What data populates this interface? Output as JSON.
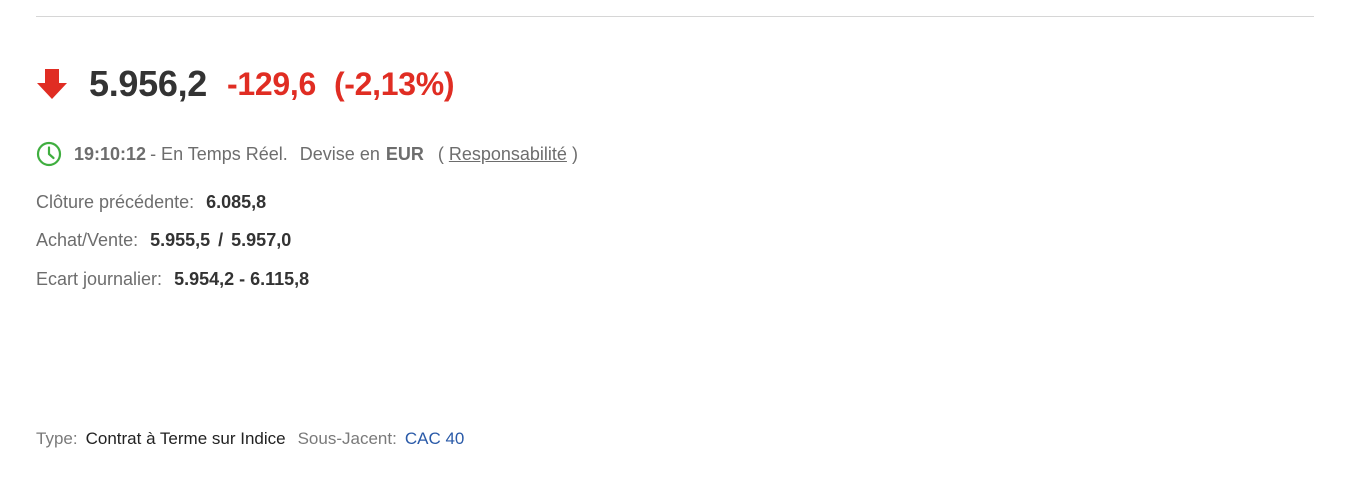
{
  "quote": {
    "last": "5.956,2",
    "change": "-129,6",
    "change_pct": "(-2,13%)",
    "direction_icon": "down-arrow-icon",
    "negative_color": "#e02d23"
  },
  "status": {
    "icon": "clock-icon",
    "icon_color": "#3fae3f",
    "time": "19:10:12",
    "realtime_text": "- En Temps Réel.",
    "currency_label": "Devise en",
    "currency": "EUR",
    "open_paren": "(",
    "disclaimer_link": "Responsabilité",
    "close_paren": ")"
  },
  "details": {
    "prev_close_label": "Clôture précédente:",
    "prev_close_value": "6.085,8",
    "bid_ask_label": "Achat/Vente:",
    "bid": "5.955,5",
    "bid_ask_sep": "/",
    "ask": "5.957,0",
    "day_range_label": "Ecart journalier:",
    "day_range_value": "5.954,2 - 6.115,8"
  },
  "footer": {
    "type_label": "Type:",
    "type_value": "Contrat à Terme sur Indice",
    "underlying_label": "Sous-Jacent:",
    "underlying_link": "CAC 40",
    "link_color": "#2a5aa8"
  }
}
